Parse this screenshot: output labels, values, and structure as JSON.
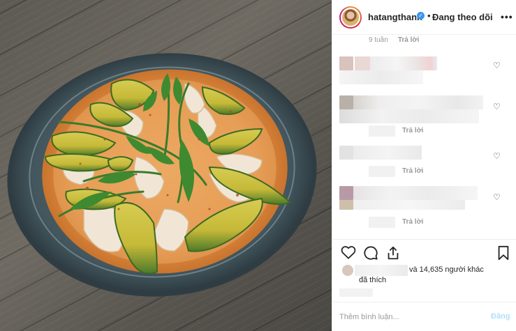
{
  "header": {
    "username": "hatangthanh",
    "verified_mark": "✓",
    "separator": "•",
    "follow_status": "Đang theo dõi",
    "more_label": "•••"
  },
  "comments": {
    "top_meta": {
      "time": "9 tuần",
      "reply": "Trả lời"
    },
    "replies": [
      "Trả lời",
      "Trả lời",
      "Trả lời"
    ]
  },
  "likes": {
    "count_text": "và 14,635 người khác",
    "liked_text": "đã thích"
  },
  "add_comment": {
    "placeholder": "Thêm bình luận...",
    "post_label": "Đăng"
  },
  "colors": {
    "accent_blue": "#3897f0",
    "post_disabled": "#b2dffc",
    "border": "#efefef",
    "muted": "#999999"
  },
  "icons": [
    "heart-icon",
    "comment-icon",
    "share-icon",
    "bookmark-icon",
    "more-icon",
    "verified-icon"
  ]
}
